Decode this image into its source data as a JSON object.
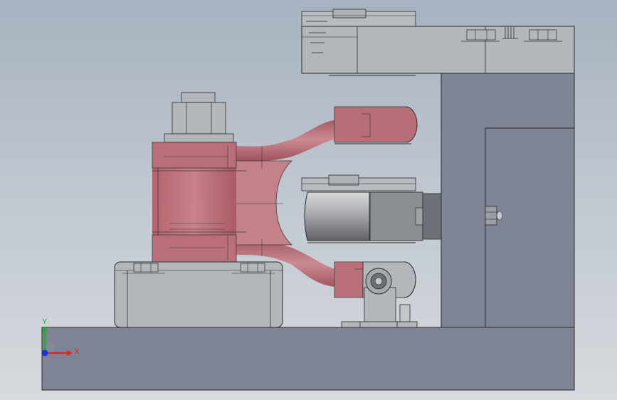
{
  "view": {
    "background_top": "#a7b2c0",
    "background_bottom": "#d6dade",
    "part_gray": "#7e8493",
    "part_light": "#b3b6bb",
    "part_red": "#b86870",
    "edge_color": "#2b2b2b"
  },
  "triad": {
    "x_label": "X",
    "y_label": "Y",
    "x_color": "#e0242a",
    "y_color": "#1fae2a",
    "z_color": "#1a32d8"
  }
}
